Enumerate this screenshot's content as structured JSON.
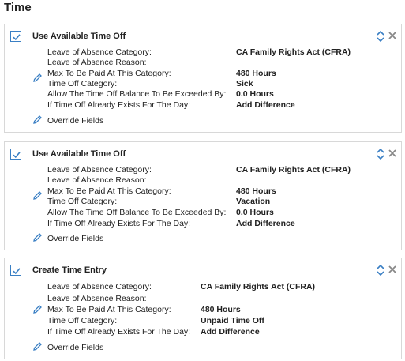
{
  "section": {
    "title": "Time"
  },
  "cards": [
    {
      "title": "Use Available Time Off",
      "fields": [
        {
          "label": "Leave of Absence Category:",
          "value": "CA Family Rights Act (CFRA)"
        },
        {
          "label": "Leave of Absence Reason:",
          "value": ""
        },
        {
          "label": "Max To Be Paid At This Category:",
          "value": "480 Hours"
        },
        {
          "label": "Time Off Category:",
          "value": "Sick"
        },
        {
          "label": "Allow The Time Off Balance To Be Exceeded By:",
          "value": "0.0 Hours"
        },
        {
          "label": "If Time Off Already Exists For The Day:",
          "value": "Add Difference"
        }
      ],
      "override_label": "Override Fields"
    },
    {
      "title": "Use Available Time Off",
      "fields": [
        {
          "label": "Leave of Absence Category:",
          "value": "CA Family Rights Act (CFRA)"
        },
        {
          "label": "Leave of Absence Reason:",
          "value": ""
        },
        {
          "label": "Max To Be Paid At This Category:",
          "value": "480 Hours"
        },
        {
          "label": "Time Off Category:",
          "value": "Vacation"
        },
        {
          "label": "Allow The Time Off Balance To Be Exceeded By:",
          "value": "0.0 Hours"
        },
        {
          "label": "If Time Off Already Exists For The Day:",
          "value": "Add Difference"
        }
      ],
      "override_label": "Override Fields"
    },
    {
      "title": "Create Time Entry",
      "fields": [
        {
          "label": "Leave of Absence Category:",
          "value": "CA Family Rights Act (CFRA)"
        },
        {
          "label": "Leave of Absence Reason:",
          "value": ""
        },
        {
          "label": "Max To Be Paid At This Category:",
          "value": "480 Hours"
        },
        {
          "label": "Time Off Category:",
          "value": "Unpaid Time Off"
        },
        {
          "label": "If Time Off Already Exists For The Day:",
          "value": "Add Difference"
        }
      ],
      "override_label": "Override Fields"
    }
  ],
  "colors": {
    "accent": "#3a7fc4",
    "border": "#d8d8d8",
    "close": "#888888"
  },
  "icons": {
    "check": "checkbox-checked-icon",
    "sort": "sort-arrows-icon",
    "close": "close-icon",
    "edit": "pencil-icon"
  }
}
